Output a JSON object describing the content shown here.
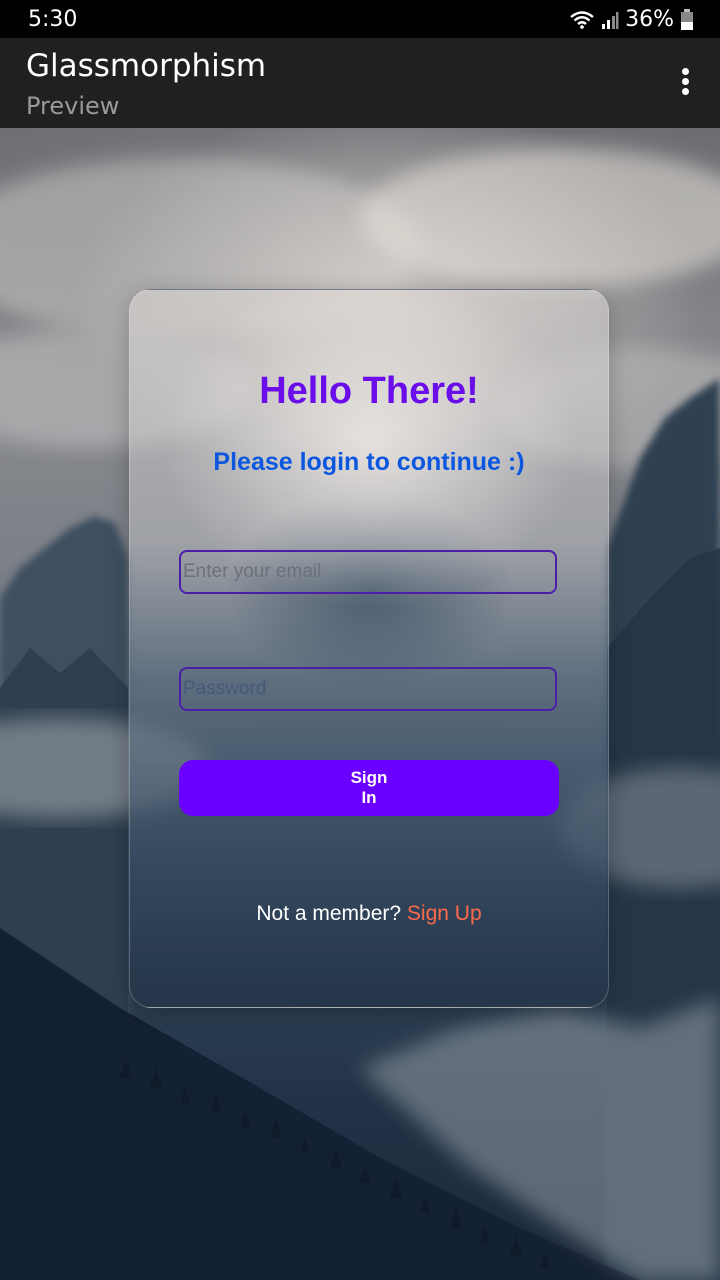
{
  "status_bar": {
    "time": "5:30",
    "battery": "36%"
  },
  "app_bar": {
    "title": "Glassmorphism",
    "subtitle": "Preview"
  },
  "login_card": {
    "title": "Hello There!",
    "subtitle": "Please login to continue :)",
    "email_placeholder": "Enter your email",
    "email_value": "",
    "password_placeholder": "Password",
    "password_value": "",
    "signin_label": "Sign In",
    "footer_text": "Not a member?",
    "signup_link": "Sign Up"
  },
  "colors": {
    "title": "#6a0dea",
    "subtitle": "#0b57e0",
    "button": "#6a00ff",
    "link": "#ff6a4d",
    "field_border": "#4a1ea8"
  },
  "icons": [
    "wifi-icon",
    "signal-icon",
    "battery-icon",
    "more-vert-icon"
  ]
}
